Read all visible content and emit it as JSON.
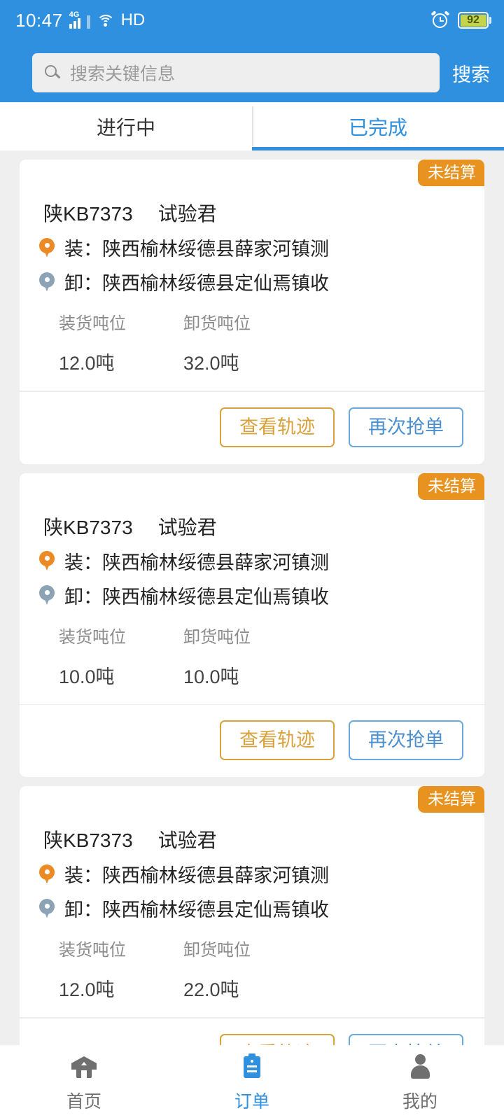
{
  "status_bar": {
    "time": "10:47",
    "network_type": "4G",
    "wifi_icon": "wifi-icon",
    "hd_label": "HD",
    "alarm_icon": "alarm-clock-icon",
    "battery_level": "92"
  },
  "header": {
    "accent_color": "#2f90e0",
    "search_placeholder": "搜索关键信息",
    "search_value": "",
    "search_button_label": "搜索",
    "search_icon": "search-icon"
  },
  "tabs": [
    {
      "label": "进行中",
      "active": false
    },
    {
      "label": "已完成",
      "active": true
    }
  ],
  "labels": {
    "load_prefix": "装：",
    "unload_prefix": "卸：",
    "load_tonnage": "装货吨位",
    "unload_tonnage": "卸货吨位"
  },
  "buttons": {
    "track_label": "查看轨迹",
    "grab_label": "再次抢单",
    "track_color": "#d9a13b",
    "grab_color": "#4a8fd0"
  },
  "orders": [
    {
      "badge": "未结算",
      "badge_color": "#e8921f",
      "plate": "陕KB7373",
      "driver": "试验君",
      "load_address": "陕西榆林绥德县薛家河镇测",
      "unload_address": "陕西榆林绥德县定仙焉镇收",
      "load_tonnage_value": "12.0吨",
      "unload_tonnage_value": "32.0吨"
    },
    {
      "badge": "未结算",
      "badge_color": "#e8921f",
      "plate": "陕KB7373",
      "driver": "试验君",
      "load_address": "陕西榆林绥德县薛家河镇测",
      "unload_address": "陕西榆林绥德县定仙焉镇收",
      "load_tonnage_value": "10.0吨",
      "unload_tonnage_value": "10.0吨"
    },
    {
      "badge": "未结算",
      "badge_color": "#e8921f",
      "plate": "陕KB7373",
      "driver": "试验君",
      "load_address": "陕西榆林绥德县薛家河镇测",
      "unload_address": "陕西榆林绥德县定仙焉镇收",
      "load_tonnage_value": "12.0吨",
      "unload_tonnage_value": "22.0吨"
    }
  ],
  "bottom_nav": [
    {
      "label": "首页",
      "icon": "home-icon",
      "active": false
    },
    {
      "label": "订单",
      "icon": "clipboard-icon",
      "active": true
    },
    {
      "label": "我的",
      "icon": "person-icon",
      "active": false
    }
  ]
}
